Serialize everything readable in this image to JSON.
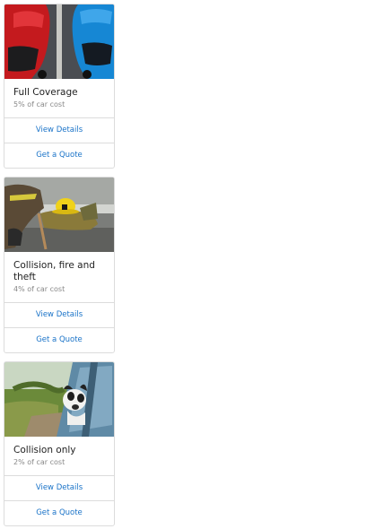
{
  "cards": [
    {
      "image_alt": "two parked cars, red and blue",
      "title": "Full Coverage",
      "subtitle": "5% of car cost",
      "details_label": "View Details",
      "quote_label": "Get a Quote"
    },
    {
      "image_alt": "firefighter resting next to yellow helmet",
      "title": "Collision, fire and theft",
      "subtitle": "4% of car cost",
      "details_label": "View Details",
      "quote_label": "Get a Quote"
    },
    {
      "image_alt": "dog looking out of a car window",
      "title": "Collision only",
      "subtitle": "2% of car cost",
      "details_label": "View Details",
      "quote_label": "Get a Quote"
    }
  ],
  "colors": {
    "link": "#1a73c8",
    "border": "#dcdcdc",
    "title": "#222222",
    "subtitle": "#888888"
  }
}
